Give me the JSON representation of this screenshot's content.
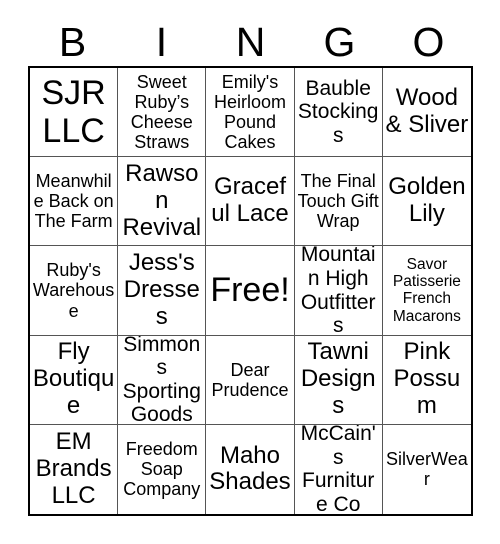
{
  "header": {
    "letters": [
      "B",
      "I",
      "N",
      "G",
      "O"
    ]
  },
  "grid": {
    "rows": [
      [
        {
          "text": "SJR LLC",
          "size": "fs-xxl"
        },
        {
          "text": "Sweet Ruby’s Cheese Straws",
          "size": "fs-md"
        },
        {
          "text": "Emily's Heirloom Pound Cakes",
          "size": "fs-md"
        },
        {
          "text": "Bauble Stockings",
          "size": "fs-lg"
        },
        {
          "text": "Wood & Sliver",
          "size": "fs-xl"
        }
      ],
      [
        {
          "text": "Meanwhile Back on The Farm",
          "size": "fs-md"
        },
        {
          "text": "Rawson Revival",
          "size": "fs-xl"
        },
        {
          "text": "Graceful Lace",
          "size": "fs-xl"
        },
        {
          "text": "The Final Touch Gift Wrap",
          "size": "fs-md"
        },
        {
          "text": "Golden Lily",
          "size": "fs-xl"
        }
      ],
      [
        {
          "text": "Ruby's Warehouse",
          "size": "fs-md"
        },
        {
          "text": "Jess's Dresses",
          "size": "fs-xl"
        },
        {
          "text": "Free!",
          "size": "fs-xxl"
        },
        {
          "text": "Mountain High Outfitters",
          "size": "fs-lg"
        },
        {
          "text": "Savor Patisserie French Macarons",
          "size": "fs-sm"
        }
      ],
      [
        {
          "text": "Fly Boutique",
          "size": "fs-xl"
        },
        {
          "text": "Simmons Sporting Goods",
          "size": "fs-lg"
        },
        {
          "text": "Dear Prudence",
          "size": "fs-md"
        },
        {
          "text": "Tawni Designs",
          "size": "fs-xl"
        },
        {
          "text": "Pink Possum",
          "size": "fs-xl"
        }
      ],
      [
        {
          "text": "EM Brands LLC",
          "size": "fs-xl"
        },
        {
          "text": "Freedom Soap Company",
          "size": "fs-md"
        },
        {
          "text": "Maho Shades",
          "size": "fs-xl"
        },
        {
          "text": "McCain's Furniture Co",
          "size": "fs-lg"
        },
        {
          "text": "SilverWear",
          "size": "fs-md"
        }
      ]
    ]
  }
}
